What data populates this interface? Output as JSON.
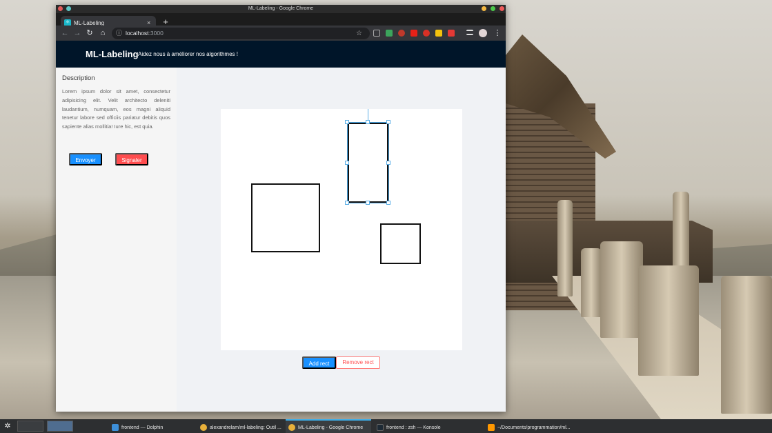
{
  "window": {
    "title": "ML-Labeling - Google Chrome"
  },
  "tab": {
    "title": "ML-Labeling",
    "close_icon": "×",
    "new_tab_icon": "+"
  },
  "address": {
    "host": "localhost",
    "port": ":3000"
  },
  "app": {
    "title": "ML-Labeling",
    "subtitle": "Aidez nous à améliorer nos algorithmes !"
  },
  "sidebar": {
    "heading": "Description",
    "text": "Lorem ipsum dolor sit amet, consectetur adipisicing elit. Velit architecto deleniti laudantium, numquam, eos magni aliquid tenetur labore sed officiis pariatur debitis quos sapiente alias mollitia! Iure hic, est quia.",
    "send_label": "Envoyer",
    "report_label": "Signaler"
  },
  "canvas_controls": {
    "add_label": "Add rect",
    "remove_label": "Remove rect"
  },
  "taskbar": {
    "tasks": [
      "frontend — Dolphin",
      "alexandrelam/ml-labeling: Outil ...",
      "ML-Labeling - Google Chrome",
      "frontend : zsh — Konsole",
      "~/Documents/programmation/ml..."
    ]
  },
  "colors": {
    "header": "#001529",
    "primary": "#1890ff",
    "danger": "#ff4d4f"
  }
}
